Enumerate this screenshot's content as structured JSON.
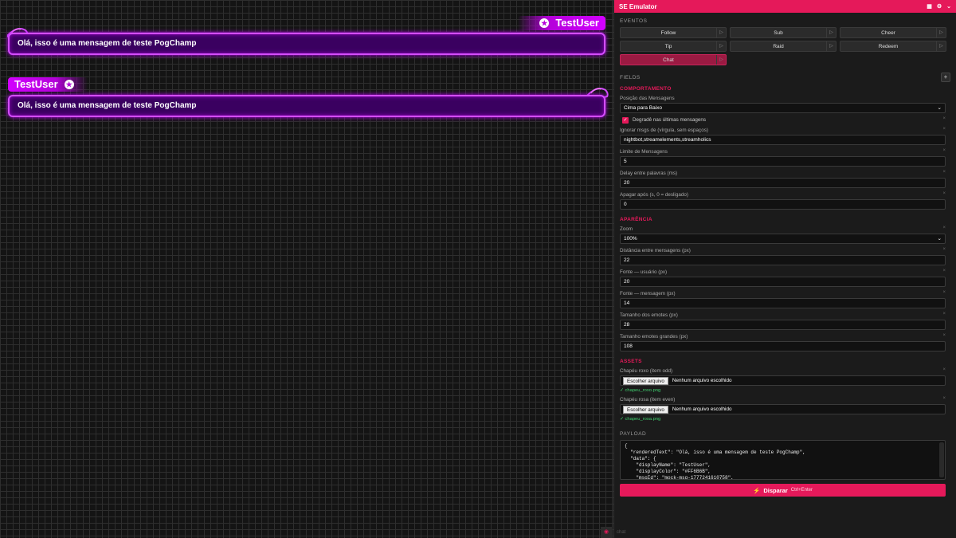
{
  "stage": {
    "messages": [
      {
        "username": "TestUser",
        "text": "Olá, isso é uma mensagem de teste PogChamp",
        "align": "right"
      },
      {
        "username": "TestUser",
        "text": "Olá, isso é uma mensagem de teste PogChamp",
        "align": "left"
      }
    ]
  },
  "panel": {
    "title": "SE Emulator",
    "events_label": "EVENTOS",
    "events": [
      "Follow",
      "Sub",
      "Cheer",
      "Tip",
      "Raid",
      "Redeem",
      "Chat"
    ],
    "active_event": "Chat",
    "fields_label": "FIELDS",
    "comportamento": {
      "title": "COMPORTAMENTO",
      "posicao_label": "Posição das Mensagens",
      "posicao_value": "Cima para Baixo",
      "degrade_label": "Degradê nas últimas mensagens",
      "ignorar_label": "Ignorar msgs de (vírgula, sem espaços)",
      "ignorar_value": "nightbot,streamelements,streamholics",
      "limite_label": "Limite de Mensagens",
      "limite_value": "5",
      "delay_label": "Delay entre palavras (ms)",
      "delay_value": "20",
      "apagar_label": "Apagar após (s, 0 = desligado)",
      "apagar_value": "0"
    },
    "aparencia": {
      "title": "APARÊNCIA",
      "zoom_label": "Zoom",
      "zoom_value": "100%",
      "distancia_label": "Distância entre mensagens (px)",
      "distancia_value": "22",
      "fonte_usuario_label": "Fonte — usuário (px)",
      "fonte_usuario_value": "20",
      "fonte_mensagem_label": "Fonte — mensagem (px)",
      "fonte_mensagem_value": "14",
      "tamanho_emotes_label": "Tamanho dos emotes (px)",
      "tamanho_emotes_value": "28",
      "tamanho_grandes_label": "Tamanho emotes grandes (px)",
      "tamanho_grandes_value": "108"
    },
    "assets": {
      "title": "ASSETS",
      "roxo_label": "Chapéu roxo (item odd)",
      "rosa_label": "Chapéu rosa (item even)",
      "choose_button": "Escolher arquivo",
      "no_file": "Nenhum arquivo escolhido",
      "roxo_file": "✓ chapeu_roxo.png",
      "rosa_file": "✓ chapeu_rosa.png"
    },
    "payload_label": "PAYLOAD",
    "payload_text": "{\n  \"renderedText\": \"Olá, isso é uma mensagem de teste PogChamp\",\n  \"data\": {\n    \"displayName\": \"TestUser\",\n    \"displayColor\": \"#FF6B6B\",\n    \"msgId\": \"mock-msg-1777241610758\",",
    "fire_button": "Disparar",
    "fire_shortcut": "Ctrl+Enter",
    "footer_text": "chat"
  },
  "colors": {
    "accent": "#e5195a",
    "neon": "#d200ff",
    "bubble": "#3a0060"
  }
}
